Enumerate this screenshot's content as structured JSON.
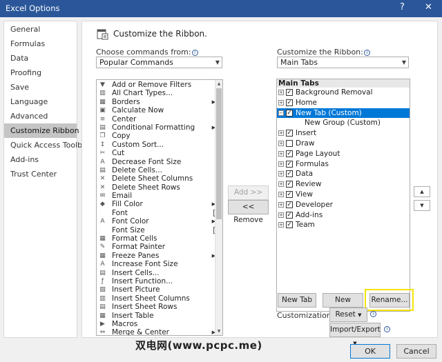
{
  "window": {
    "title": "Excel Options",
    "help": "?",
    "close": "✕"
  },
  "nav": {
    "items": [
      {
        "label": "General",
        "selected": false
      },
      {
        "label": "Formulas",
        "selected": false
      },
      {
        "label": "Data",
        "selected": false
      },
      {
        "label": "Proofing",
        "selected": false
      },
      {
        "label": "Save",
        "selected": false
      },
      {
        "label": "Language",
        "selected": false
      },
      {
        "label": "Advanced",
        "selected": false
      },
      {
        "label": "Customize Ribbon",
        "selected": true
      },
      {
        "label": "Quick Access Toolbar",
        "selected": false
      },
      {
        "label": "Add-ins",
        "selected": false
      },
      {
        "label": "Trust Center",
        "selected": false
      }
    ]
  },
  "header": {
    "title": "Customize the Ribbon."
  },
  "left_panel": {
    "label": "Choose commands from:",
    "dropdown_value": "Popular Commands",
    "commands": [
      {
        "label": "Add or Remove Filters",
        "icon": "filter-icon",
        "glyph": "▼",
        "suffix": ""
      },
      {
        "label": "All Chart Types...",
        "icon": "chart-icon",
        "glyph": "▥",
        "suffix": ""
      },
      {
        "label": "Borders",
        "icon": "borders-icon",
        "glyph": "▦",
        "suffix": "submenu"
      },
      {
        "label": "Calculate Now",
        "icon": "calculator-icon",
        "glyph": "▣",
        "suffix": ""
      },
      {
        "label": "Center",
        "icon": "center-icon",
        "glyph": "≡",
        "suffix": ""
      },
      {
        "label": "Conditional Formatting",
        "icon": "conditional-formatting-icon",
        "glyph": "▤",
        "suffix": "submenu"
      },
      {
        "label": "Copy",
        "icon": "copy-icon",
        "glyph": "❐",
        "suffix": ""
      },
      {
        "label": "Custom Sort...",
        "icon": "sort-icon",
        "glyph": "↕",
        "suffix": ""
      },
      {
        "label": "Cut",
        "icon": "cut-icon",
        "glyph": "✂",
        "suffix": ""
      },
      {
        "label": "Decrease Font Size",
        "icon": "decrease-font-icon",
        "glyph": "A",
        "suffix": ""
      },
      {
        "label": "Delete Cells...",
        "icon": "delete-cells-icon",
        "glyph": "▤",
        "suffix": ""
      },
      {
        "label": "Delete Sheet Columns",
        "icon": "delete-columns-icon",
        "glyph": "✕",
        "suffix": ""
      },
      {
        "label": "Delete Sheet Rows",
        "icon": "delete-rows-icon",
        "glyph": "✕",
        "suffix": ""
      },
      {
        "label": "Email",
        "icon": "email-icon",
        "glyph": "✉",
        "suffix": ""
      },
      {
        "label": "Fill Color",
        "icon": "fill-color-icon",
        "glyph": "◆",
        "suffix": "submenu"
      },
      {
        "label": "Font",
        "icon": "font-icon",
        "glyph": "",
        "suffix": "box"
      },
      {
        "label": "Font Color",
        "icon": "font-color-icon",
        "glyph": "A",
        "suffix": "submenu"
      },
      {
        "label": "Font Size",
        "icon": "font-size-icon",
        "glyph": "",
        "suffix": "box"
      },
      {
        "label": "Format Cells",
        "icon": "format-cells-icon",
        "glyph": "▦",
        "suffix": ""
      },
      {
        "label": "Format Painter",
        "icon": "format-painter-icon",
        "glyph": "✎",
        "suffix": ""
      },
      {
        "label": "Freeze Panes",
        "icon": "freeze-panes-icon",
        "glyph": "▦",
        "suffix": "submenu"
      },
      {
        "label": "Increase Font Size",
        "icon": "increase-font-icon",
        "glyph": "A",
        "suffix": ""
      },
      {
        "label": "Insert Cells...",
        "icon": "insert-cells-icon",
        "glyph": "▤",
        "suffix": ""
      },
      {
        "label": "Insert Function...",
        "icon": "insert-function-icon",
        "glyph": "ƒ",
        "suffix": ""
      },
      {
        "label": "Insert Picture",
        "icon": "insert-picture-icon",
        "glyph": "▨",
        "suffix": ""
      },
      {
        "label": "Insert Sheet Columns",
        "icon": "insert-columns-icon",
        "glyph": "▥",
        "suffix": ""
      },
      {
        "label": "Insert Sheet Rows",
        "icon": "insert-rows-icon",
        "glyph": "▤",
        "suffix": ""
      },
      {
        "label": "Insert Table",
        "icon": "insert-table-icon",
        "glyph": "▦",
        "suffix": ""
      },
      {
        "label": "Macros",
        "icon": "macros-icon",
        "glyph": "▶",
        "suffix": ""
      },
      {
        "label": "Merge & Center",
        "icon": "merge-center-icon",
        "glyph": "⇔",
        "suffix": "submenu"
      }
    ]
  },
  "middle_buttons": {
    "add": "Add >>",
    "remove": "<< Remove"
  },
  "right_panel": {
    "label": "Customize the Ribbon:",
    "dropdown_value": "Main Tabs",
    "tree_header": "Main Tabs",
    "tabs": [
      {
        "label": "Background Removal",
        "checked": true,
        "expander": "+",
        "selected": false,
        "group": false
      },
      {
        "label": "Home",
        "checked": true,
        "expander": "+",
        "selected": false,
        "group": false
      },
      {
        "label": "New Tab (Custom)",
        "checked": true,
        "expander": "−",
        "selected": true,
        "group": false
      },
      {
        "label": "New Group (Custom)",
        "checked": false,
        "expander": "",
        "selected": false,
        "group": true
      },
      {
        "label": "Insert",
        "checked": true,
        "expander": "+",
        "selected": false,
        "group": false
      },
      {
        "label": "Draw",
        "checked": false,
        "expander": "+",
        "selected": false,
        "group": false
      },
      {
        "label": "Page Layout",
        "checked": true,
        "expander": "+",
        "selected": false,
        "group": false
      },
      {
        "label": "Formulas",
        "checked": true,
        "expander": "+",
        "selected": false,
        "group": false
      },
      {
        "label": "Data",
        "checked": true,
        "expander": "+",
        "selected": false,
        "group": false
      },
      {
        "label": "Review",
        "checked": true,
        "expander": "+",
        "selected": false,
        "group": false
      },
      {
        "label": "View",
        "checked": true,
        "expander": "+",
        "selected": false,
        "group": false
      },
      {
        "label": "Developer",
        "checked": true,
        "expander": "+",
        "selected": false,
        "group": false
      },
      {
        "label": "Add-ins",
        "checked": true,
        "expander": "+",
        "selected": false,
        "group": false
      },
      {
        "label": "Team",
        "checked": true,
        "expander": "+",
        "selected": false,
        "group": false
      }
    ],
    "new_tab": "New Tab",
    "new_group": "New Group",
    "rename": "Rename...",
    "customizations_label": "Customizations:",
    "reset": "Reset",
    "import_export": "Import/Export",
    "move_up": "▲",
    "move_down": "▼"
  },
  "footer": {
    "ok": "OK",
    "cancel": "Cancel"
  },
  "watermark": "双电网(www.pcpc.me)",
  "colors": {
    "titlebar": "#2b579a",
    "selection": "#0078d7",
    "highlight": "#f5e30a"
  }
}
